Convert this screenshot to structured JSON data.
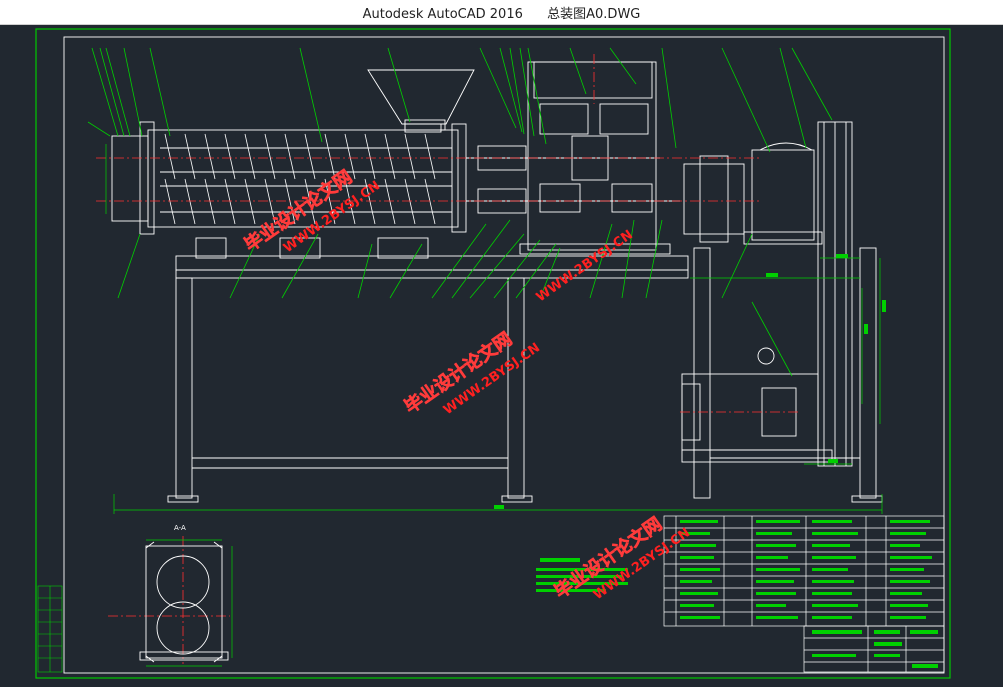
{
  "window": {
    "app_name": "Autodesk AutoCAD 2016",
    "file_name": "总装图A0.DWG"
  },
  "colors": {
    "background": "#212830",
    "lines": "#ffffff",
    "frame": "#00c800",
    "centerline": "#ff3030",
    "watermark": "#ff3b3b"
  },
  "watermarks": [
    {
      "cn": "毕业设计论文网",
      "url": "WWW.2BYSJ.CN"
    },
    {
      "cn": "毕业设计论文网",
      "url": "WWW.2BYSJ.CN"
    },
    {
      "cn": "毕业设计论文网",
      "url": "WWW.2BYSJ.CN"
    },
    {
      "cn": "毕业设计论文网",
      "url": "WWW.2BYSJ.CN"
    }
  ],
  "section_label": "A-A"
}
